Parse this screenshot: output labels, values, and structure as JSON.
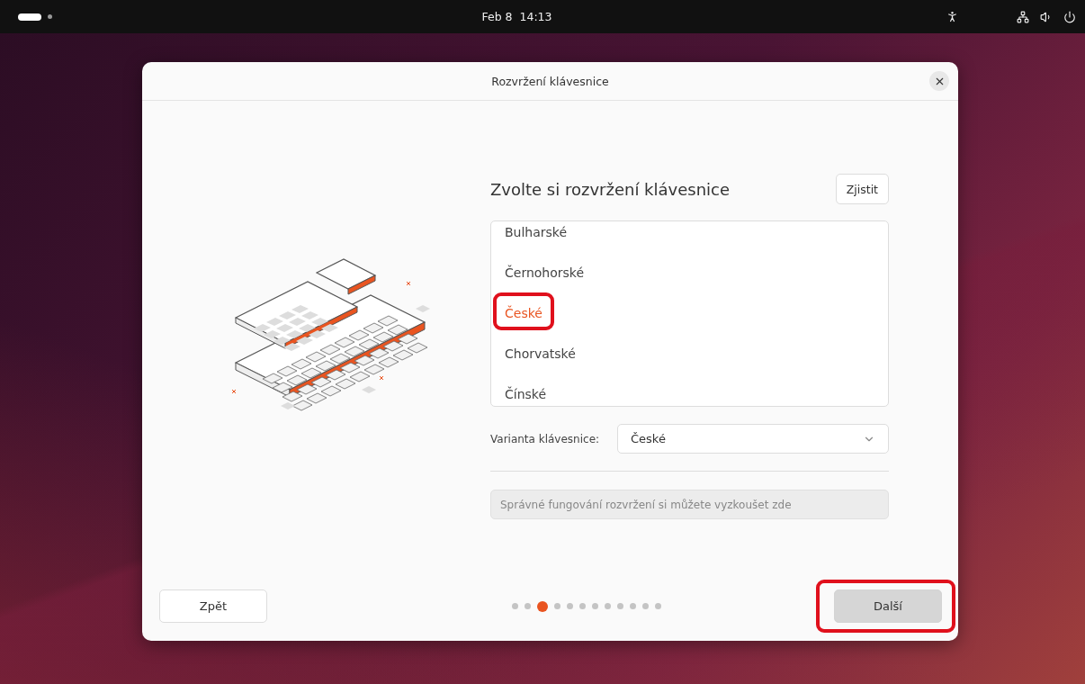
{
  "top_bar": {
    "clock": "Feb 8  14:13"
  },
  "dialog": {
    "title": "Rozvržení klávesnice"
  },
  "heading": "Zvolte si rozvržení klávesnice",
  "detect_button": "Zjistit",
  "layouts": [
    {
      "label": "Bulharské",
      "selected": false,
      "annotated": false
    },
    {
      "label": "Černohorské",
      "selected": false,
      "annotated": false
    },
    {
      "label": "České",
      "selected": true,
      "annotated": true
    },
    {
      "label": "Chorvatské",
      "selected": false,
      "annotated": false
    },
    {
      "label": "Čínské",
      "selected": false,
      "annotated": false
    }
  ],
  "variant": {
    "label": "Varianta klávesnice:",
    "value": "České"
  },
  "test_field": {
    "placeholder": "Správné fungování rozvržení si můžete vyzkoušet zde"
  },
  "back_button": "Zpět",
  "steps": [
    {
      "selected": false
    },
    {
      "selected": false
    },
    {
      "selected": true
    },
    {
      "selected": false
    },
    {
      "selected": false
    },
    {
      "selected": false
    },
    {
      "selected": false
    },
    {
      "selected": false
    },
    {
      "selected": false
    },
    {
      "selected": false
    },
    {
      "selected": false
    },
    {
      "selected": false
    }
  ],
  "next_button": {
    "label": "Další",
    "annotated": true
  }
}
